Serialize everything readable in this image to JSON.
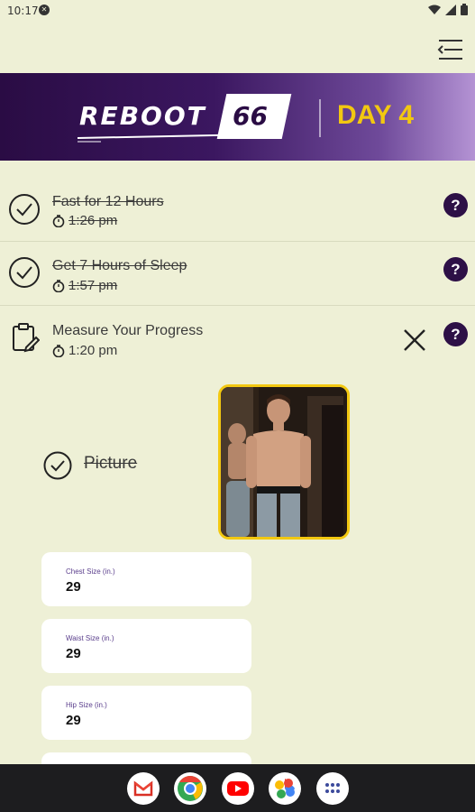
{
  "status": {
    "time": "10:17"
  },
  "banner": {
    "logo": "REBOOT",
    "logo_number": "66",
    "day": "DAY 4"
  },
  "tasks": [
    {
      "label": "Fast for 12 Hours",
      "time": "1:26 pm"
    },
    {
      "label": "Get 7 Hours of Sleep",
      "time": "1:57 pm"
    },
    {
      "label": "Measure Your Progress",
      "time": "1:20 pm"
    }
  ],
  "help_label": "?",
  "picture_label": "Picture",
  "fields": [
    {
      "label": "Chest Size (in.)",
      "value": "29"
    },
    {
      "label": "Waist Size (in.)",
      "value": "29"
    },
    {
      "label": "Hip Size (in.)",
      "value": "29"
    }
  ],
  "colors": {
    "background": "#eef0d6",
    "accent": "#2d1046",
    "highlight": "#f2c811"
  }
}
